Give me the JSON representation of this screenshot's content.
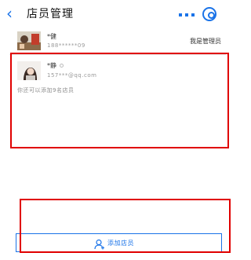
{
  "nav": {
    "back_icon": "chevron-left-icon",
    "title": "店员管理",
    "more_icon": "more-dots-icon",
    "close_icon": "target-close-icon",
    "accent": "#1a73e8"
  },
  "members": [
    {
      "name": "*健",
      "phone": "188******09",
      "role": "我是管理员",
      "avatar_icon": "avatar-photo-icon"
    },
    {
      "name": "*静",
      "email": "157***@qq.com",
      "status_icon": "circle-status-icon",
      "avatar_icon": "avatar-photo-icon"
    }
  ],
  "hint_text": "你还可以添加9名店员",
  "add_button": {
    "label": "添加店员",
    "icon": "add-user-icon"
  },
  "highlight_color": "#e00000"
}
